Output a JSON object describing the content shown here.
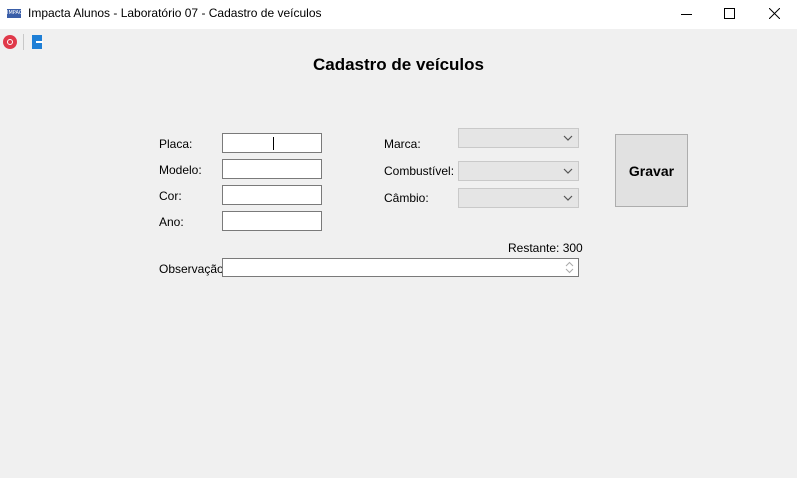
{
  "window": {
    "title": "Impacta Alunos - Laboratório 07 - Cadastro de veículos",
    "app_icon_text": "IMPACTA"
  },
  "toolbar": {
    "items": [
      {
        "icon": "home-icon"
      },
      {
        "icon": "exit-icon"
      }
    ]
  },
  "form": {
    "title": "Cadastro de veículos",
    "placa_label": "Placa:",
    "placa_value": "",
    "modelo_label": "Modelo:",
    "modelo_value": "",
    "cor_label": "Cor:",
    "cor_value": "",
    "ano_label": "Ano:",
    "ano_value": "",
    "marca_label": "Marca:",
    "marca_value": "",
    "combustivel_label": "Combustível:",
    "combustivel_value": "",
    "cambio_label": "Câmbio:",
    "cambio_value": "",
    "gravar_label": "Gravar",
    "restante_text": "Restante: 300",
    "observacao_label": "Observação:",
    "observacao_value": ""
  },
  "colors": {
    "background": "#f0f0f0",
    "disabled_combo": "#e5e5e5",
    "button_face": "#e1e1e1"
  }
}
